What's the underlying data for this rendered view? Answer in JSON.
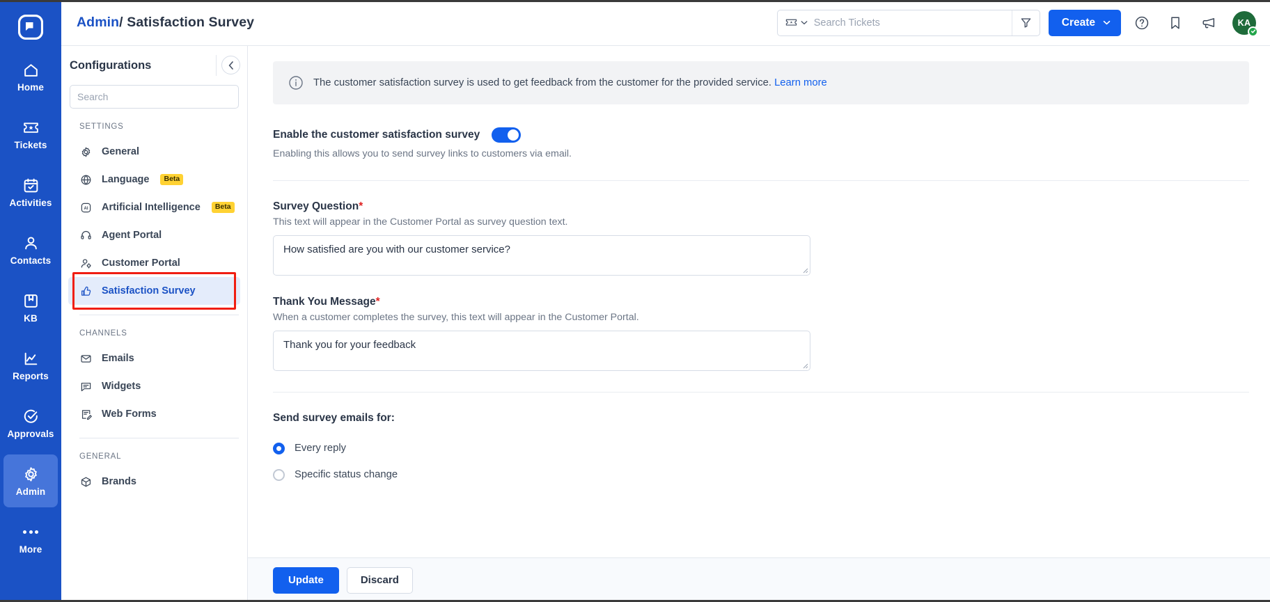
{
  "colors": {
    "rail_bg": "#1B52C5",
    "accent": "#1260EE",
    "active_item_bg": "#E4ECFB",
    "highlight_red": "#F01E12",
    "beta_badge": "#FFD233",
    "avatar_bg": "#1E6B3A",
    "status_green": "#22A54A"
  },
  "rail": {
    "logo_icon": "app-logo-icon",
    "items": [
      {
        "label": "Home",
        "icon": "home-icon",
        "active": false
      },
      {
        "label": "Tickets",
        "icon": "ticket-icon",
        "active": false
      },
      {
        "label": "Activities",
        "icon": "calendar-check-icon",
        "active": false
      },
      {
        "label": "Contacts",
        "icon": "person-icon",
        "active": false
      },
      {
        "label": "KB",
        "icon": "book-icon",
        "active": false
      },
      {
        "label": "Reports",
        "icon": "chart-line-icon",
        "active": false
      },
      {
        "label": "Approvals",
        "icon": "check-circle-icon",
        "active": false
      },
      {
        "label": "Admin",
        "icon": "gear-icon",
        "active": true
      },
      {
        "label": "More",
        "icon": "ellipsis-icon",
        "active": false
      }
    ]
  },
  "topbar": {
    "breadcrumb_link": "Admin",
    "breadcrumb_separator": "/",
    "breadcrumb_current": "Satisfaction Survey",
    "search": {
      "type_icon": "ticket-icon",
      "type_chevron": "chevron-down-icon",
      "placeholder": "Search Tickets",
      "value": "",
      "filter_icon": "filter-icon"
    },
    "create_label": "Create",
    "create_chevron": "chevron-down-icon",
    "help_icon": "help-circle-icon",
    "bookmark_icon": "bookmark-icon",
    "announce_icon": "megaphone-icon",
    "avatar_initials": "KA",
    "avatar_badge_icon": "check-badge-icon"
  },
  "config_panel": {
    "title": "Configurations",
    "collapse_icon": "chevron-left-icon",
    "search_placeholder": "Search",
    "search_value": "",
    "sections": [
      {
        "label": "SETTINGS",
        "items": [
          {
            "label": "General",
            "icon": "gear-icon",
            "badge": null,
            "active": false,
            "highlighted": false
          },
          {
            "label": "Language",
            "icon": "globe-icon",
            "badge": "Beta",
            "active": false,
            "highlighted": false
          },
          {
            "label": "Artificial Intelligence",
            "icon": "ai-icon",
            "badge": "Beta",
            "active": false,
            "highlighted": false
          },
          {
            "label": "Agent Portal",
            "icon": "headset-icon",
            "badge": null,
            "active": false,
            "highlighted": false
          },
          {
            "label": "Customer Portal",
            "icon": "user-gear-icon",
            "badge": null,
            "active": false,
            "highlighted": false
          },
          {
            "label": "Satisfaction Survey",
            "icon": "thumbs-up-icon",
            "badge": null,
            "active": true,
            "highlighted": true
          }
        ]
      },
      {
        "label": "CHANNELS",
        "items": [
          {
            "label": "Emails",
            "icon": "envelope-icon",
            "badge": null,
            "active": false,
            "highlighted": false
          },
          {
            "label": "Widgets",
            "icon": "chat-box-icon",
            "badge": null,
            "active": false,
            "highlighted": false
          },
          {
            "label": "Web Forms",
            "icon": "form-edit-icon",
            "badge": null,
            "active": false,
            "highlighted": false
          }
        ]
      },
      {
        "label": "GENERAL",
        "items": [
          {
            "label": "Brands",
            "icon": "cube-icon",
            "badge": null,
            "active": false,
            "highlighted": false
          }
        ]
      }
    ]
  },
  "main": {
    "info_banner": {
      "icon": "info-circle-icon",
      "text": "The customer satisfaction survey is used to get feedback from the customer for the provided service.",
      "link_label": "Learn more"
    },
    "enable_toggle": {
      "label": "Enable the customer satisfaction survey",
      "state": "on",
      "hint": "Enabling this allows you to send survey links to customers via email."
    },
    "survey_question": {
      "label": "Survey Question",
      "required_mark": "*",
      "hint": "This text will appear in the Customer Portal as survey question text.",
      "value": "How satisfied are you with our customer service?"
    },
    "thank_you_message": {
      "label": "Thank You Message",
      "required_mark": "*",
      "hint": "When a customer completes the survey, this text will appear in the Customer Portal.",
      "value": "Thank you for your feedback"
    },
    "send_survey": {
      "title": "Send survey emails for:",
      "options": [
        {
          "label": "Every reply",
          "selected": true
        },
        {
          "label": "Specific status change",
          "selected": false
        }
      ]
    }
  },
  "footer": {
    "update_label": "Update",
    "discard_label": "Discard"
  }
}
